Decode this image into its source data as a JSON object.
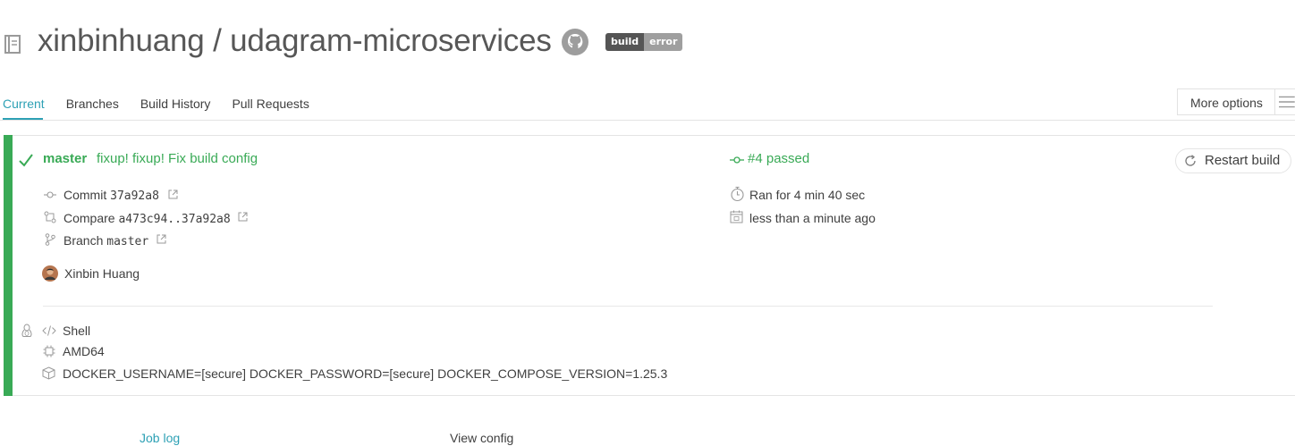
{
  "header": {
    "owner": "xinbinhuang",
    "separator": " / ",
    "repo": "udagram-microservices",
    "badge": {
      "left": "build",
      "right": "error"
    }
  },
  "tabs": [
    {
      "label": "Current",
      "active": true
    },
    {
      "label": "Branches",
      "active": false
    },
    {
      "label": "Build History",
      "active": false
    },
    {
      "label": "Pull Requests",
      "active": false
    }
  ],
  "more_options": {
    "label": "More options"
  },
  "build": {
    "status": "passed",
    "branch": "master",
    "message": "fixup! fixup! Fix build config",
    "number_label": "#4 passed",
    "restart_label": "Restart build",
    "commit": {
      "label": "Commit",
      "value": "37a92a8"
    },
    "compare": {
      "label": "Compare",
      "value": "a473c94..37a92a8"
    },
    "branch_row": {
      "label": "Branch",
      "value": "master"
    },
    "author": "Xinbin Huang",
    "duration": "Ran for 4 min 40 sec",
    "finished": "less than a minute ago",
    "language": "Shell",
    "arch": "AMD64",
    "env": "DOCKER_USERNAME=[secure] DOCKER_PASSWORD=[secure] DOCKER_COMPOSE_VERSION=1.25.3"
  },
  "bottom_tabs": {
    "job_log": "Job log",
    "view_config": "View config"
  },
  "colors": {
    "passed": "#39aa56",
    "accent": "#2ea1b5",
    "badge_dark": "#555555",
    "badge_light": "#9f9f9f"
  }
}
